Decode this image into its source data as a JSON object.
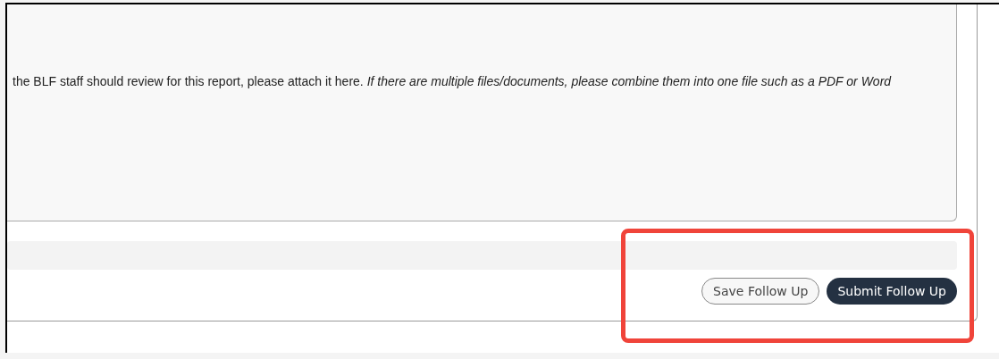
{
  "instructions": "the BLF staff should review for this report, please attach it here. *If there are multiple files/documents, please combine them into one file such as a PDF or Word*",
  "buttons": [
    {
      "label": "Save Follow Up",
      "kind": "secondary"
    },
    {
      "label": "Submit Follow Up",
      "kind": "primary"
    }
  ],
  "highlight": {
    "color": "#f0443a"
  }
}
